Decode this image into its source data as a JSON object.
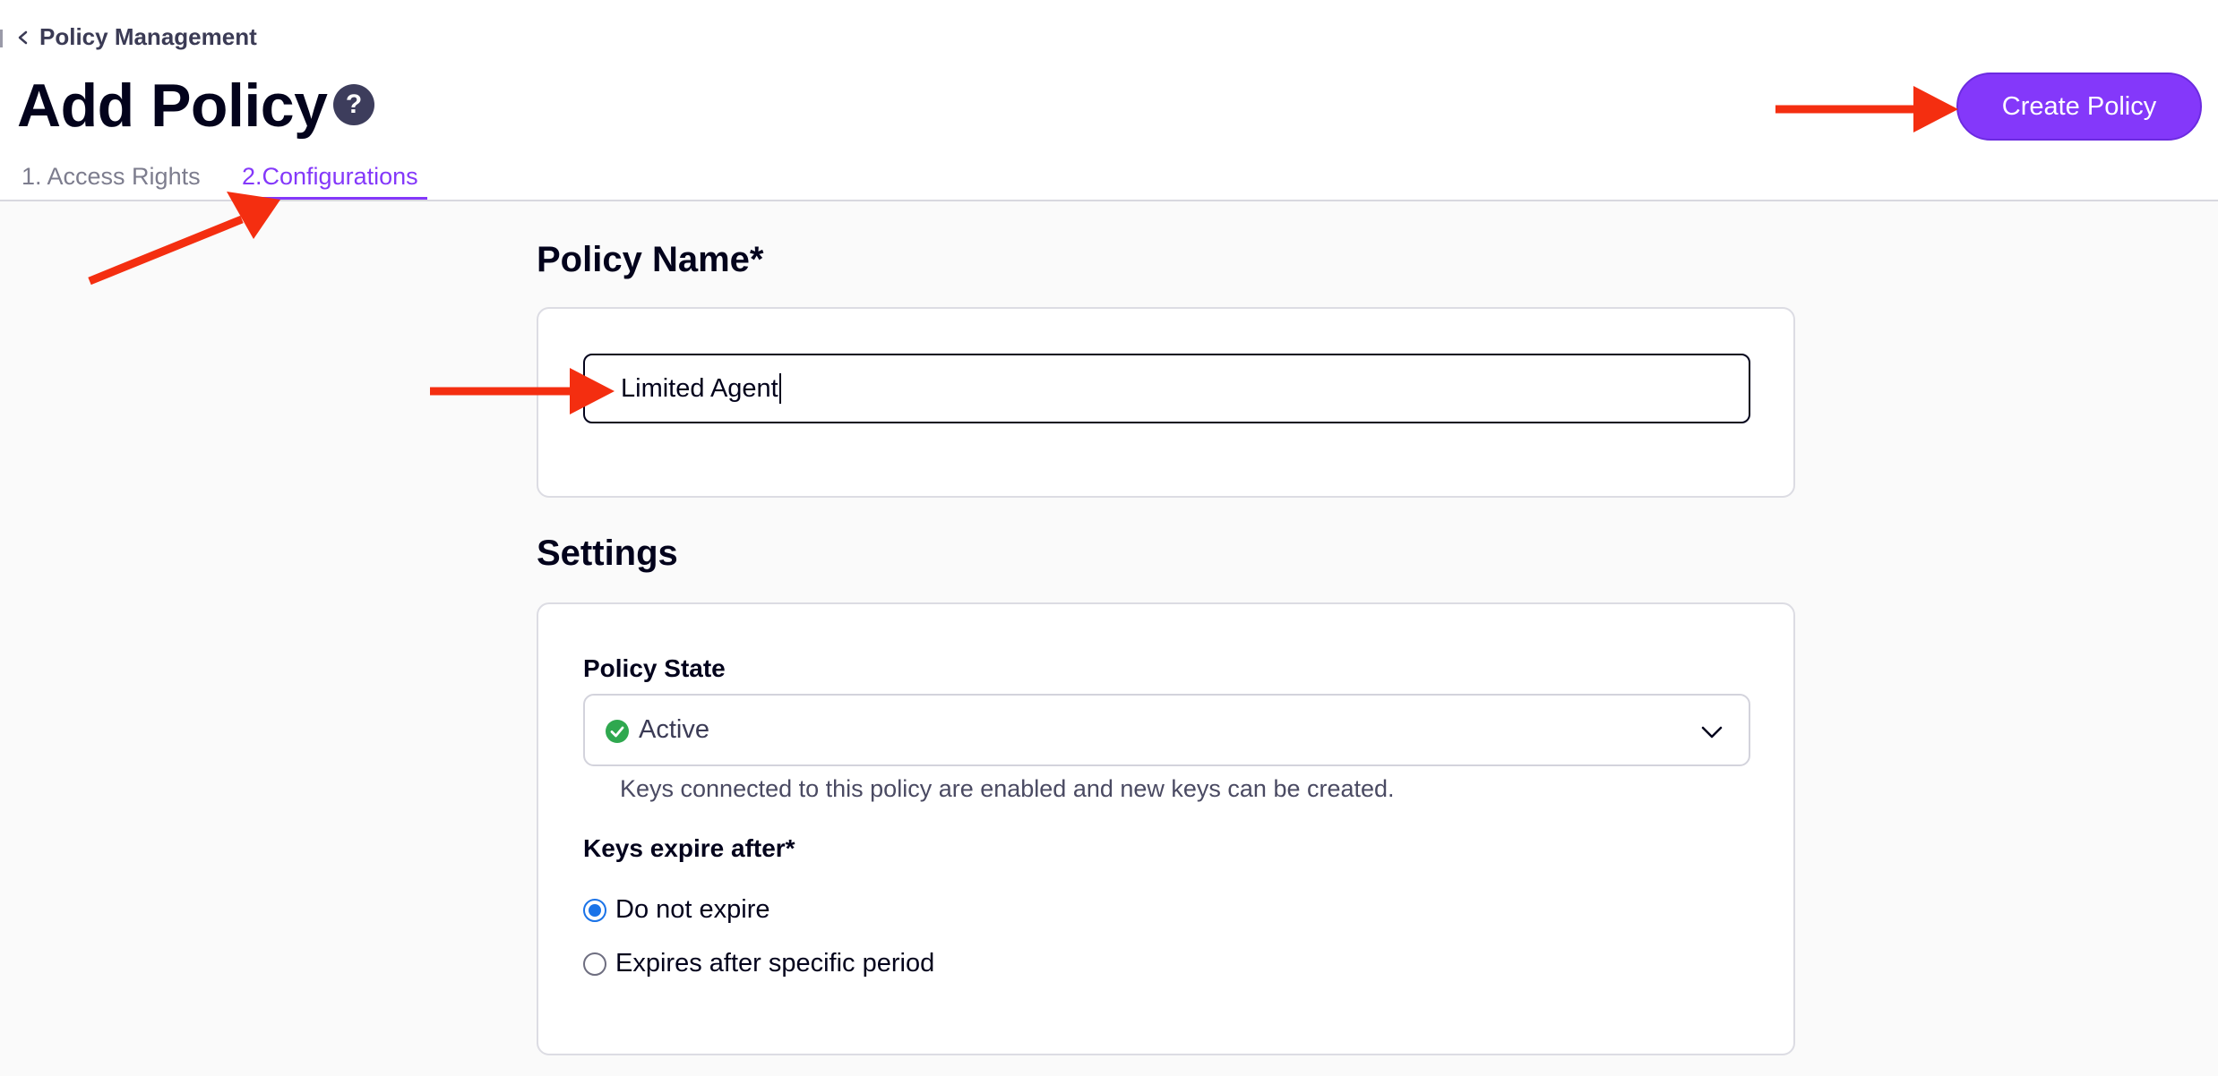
{
  "breadcrumb": {
    "label": "Policy Management"
  },
  "page": {
    "title": "Add Policy",
    "help_symbol": "?"
  },
  "tabs": [
    {
      "label": "1. Access Rights",
      "active": false
    },
    {
      "label": "2.Configurations",
      "active": true
    }
  ],
  "actions": {
    "create_label": "Create Policy"
  },
  "policy_name": {
    "heading": "Policy Name*",
    "value": "Limited Agent"
  },
  "settings": {
    "heading": "Settings",
    "state": {
      "label": "Policy State",
      "value": "Active",
      "helper": "Keys connected to this policy are enabled and new keys can be created."
    },
    "expiry": {
      "label": "Keys expire after*",
      "options": [
        {
          "label": "Do not expire",
          "selected": true
        },
        {
          "label": "Expires after specific period",
          "selected": false
        }
      ]
    }
  },
  "colors": {
    "accent": "#8438fa",
    "annotation_arrow": "#f42e10",
    "status_active": "#2fa84f",
    "radio_selected": "#1a73e8"
  }
}
